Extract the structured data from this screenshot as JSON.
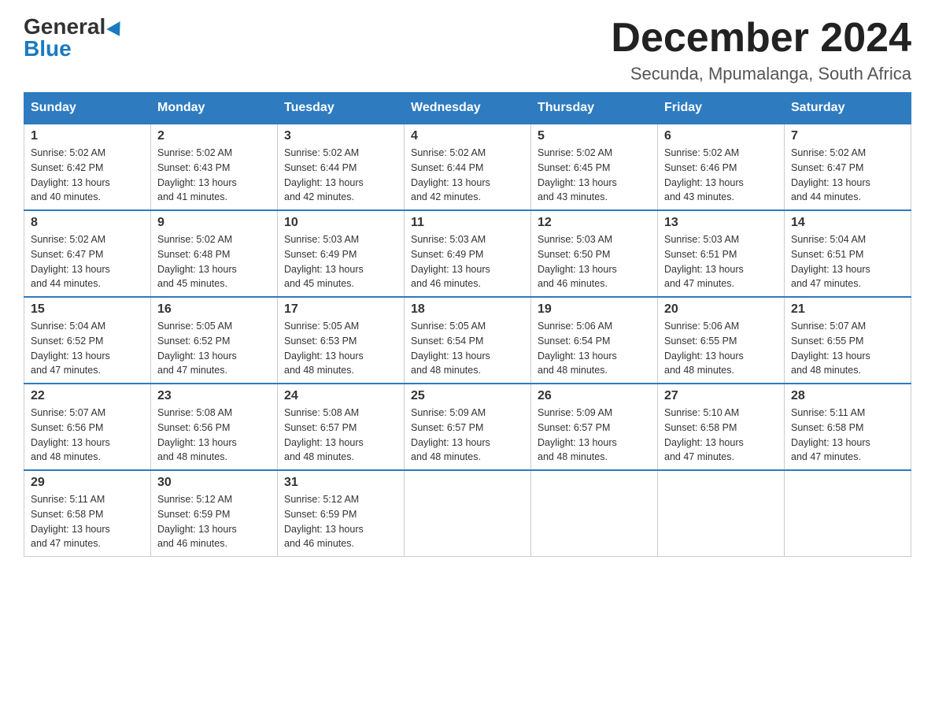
{
  "header": {
    "logo_general": "General",
    "logo_blue": "Blue",
    "month_title": "December 2024",
    "location": "Secunda, Mpumalanga, South Africa"
  },
  "weekdays": [
    "Sunday",
    "Monday",
    "Tuesday",
    "Wednesday",
    "Thursday",
    "Friday",
    "Saturday"
  ],
  "weeks": [
    [
      {
        "day": "1",
        "sunrise": "5:02 AM",
        "sunset": "6:42 PM",
        "daylight": "13 hours and 40 minutes."
      },
      {
        "day": "2",
        "sunrise": "5:02 AM",
        "sunset": "6:43 PM",
        "daylight": "13 hours and 41 minutes."
      },
      {
        "day": "3",
        "sunrise": "5:02 AM",
        "sunset": "6:44 PM",
        "daylight": "13 hours and 42 minutes."
      },
      {
        "day": "4",
        "sunrise": "5:02 AM",
        "sunset": "6:44 PM",
        "daylight": "13 hours and 42 minutes."
      },
      {
        "day": "5",
        "sunrise": "5:02 AM",
        "sunset": "6:45 PM",
        "daylight": "13 hours and 43 minutes."
      },
      {
        "day": "6",
        "sunrise": "5:02 AM",
        "sunset": "6:46 PM",
        "daylight": "13 hours and 43 minutes."
      },
      {
        "day": "7",
        "sunrise": "5:02 AM",
        "sunset": "6:47 PM",
        "daylight": "13 hours and 44 minutes."
      }
    ],
    [
      {
        "day": "8",
        "sunrise": "5:02 AM",
        "sunset": "6:47 PM",
        "daylight": "13 hours and 44 minutes."
      },
      {
        "day": "9",
        "sunrise": "5:02 AM",
        "sunset": "6:48 PM",
        "daylight": "13 hours and 45 minutes."
      },
      {
        "day": "10",
        "sunrise": "5:03 AM",
        "sunset": "6:49 PM",
        "daylight": "13 hours and 45 minutes."
      },
      {
        "day": "11",
        "sunrise": "5:03 AM",
        "sunset": "6:49 PM",
        "daylight": "13 hours and 46 minutes."
      },
      {
        "day": "12",
        "sunrise": "5:03 AM",
        "sunset": "6:50 PM",
        "daylight": "13 hours and 46 minutes."
      },
      {
        "day": "13",
        "sunrise": "5:03 AM",
        "sunset": "6:51 PM",
        "daylight": "13 hours and 47 minutes."
      },
      {
        "day": "14",
        "sunrise": "5:04 AM",
        "sunset": "6:51 PM",
        "daylight": "13 hours and 47 minutes."
      }
    ],
    [
      {
        "day": "15",
        "sunrise": "5:04 AM",
        "sunset": "6:52 PM",
        "daylight": "13 hours and 47 minutes."
      },
      {
        "day": "16",
        "sunrise": "5:05 AM",
        "sunset": "6:52 PM",
        "daylight": "13 hours and 47 minutes."
      },
      {
        "day": "17",
        "sunrise": "5:05 AM",
        "sunset": "6:53 PM",
        "daylight": "13 hours and 48 minutes."
      },
      {
        "day": "18",
        "sunrise": "5:05 AM",
        "sunset": "6:54 PM",
        "daylight": "13 hours and 48 minutes."
      },
      {
        "day": "19",
        "sunrise": "5:06 AM",
        "sunset": "6:54 PM",
        "daylight": "13 hours and 48 minutes."
      },
      {
        "day": "20",
        "sunrise": "5:06 AM",
        "sunset": "6:55 PM",
        "daylight": "13 hours and 48 minutes."
      },
      {
        "day": "21",
        "sunrise": "5:07 AM",
        "sunset": "6:55 PM",
        "daylight": "13 hours and 48 minutes."
      }
    ],
    [
      {
        "day": "22",
        "sunrise": "5:07 AM",
        "sunset": "6:56 PM",
        "daylight": "13 hours and 48 minutes."
      },
      {
        "day": "23",
        "sunrise": "5:08 AM",
        "sunset": "6:56 PM",
        "daylight": "13 hours and 48 minutes."
      },
      {
        "day": "24",
        "sunrise": "5:08 AM",
        "sunset": "6:57 PM",
        "daylight": "13 hours and 48 minutes."
      },
      {
        "day": "25",
        "sunrise": "5:09 AM",
        "sunset": "6:57 PM",
        "daylight": "13 hours and 48 minutes."
      },
      {
        "day": "26",
        "sunrise": "5:09 AM",
        "sunset": "6:57 PM",
        "daylight": "13 hours and 48 minutes."
      },
      {
        "day": "27",
        "sunrise": "5:10 AM",
        "sunset": "6:58 PM",
        "daylight": "13 hours and 47 minutes."
      },
      {
        "day": "28",
        "sunrise": "5:11 AM",
        "sunset": "6:58 PM",
        "daylight": "13 hours and 47 minutes."
      }
    ],
    [
      {
        "day": "29",
        "sunrise": "5:11 AM",
        "sunset": "6:58 PM",
        "daylight": "13 hours and 47 minutes."
      },
      {
        "day": "30",
        "sunrise": "5:12 AM",
        "sunset": "6:59 PM",
        "daylight": "13 hours and 46 minutes."
      },
      {
        "day": "31",
        "sunrise": "5:12 AM",
        "sunset": "6:59 PM",
        "daylight": "13 hours and 46 minutes."
      },
      null,
      null,
      null,
      null
    ]
  ],
  "labels": {
    "sunrise": "Sunrise:",
    "sunset": "Sunset:",
    "daylight": "Daylight:"
  }
}
